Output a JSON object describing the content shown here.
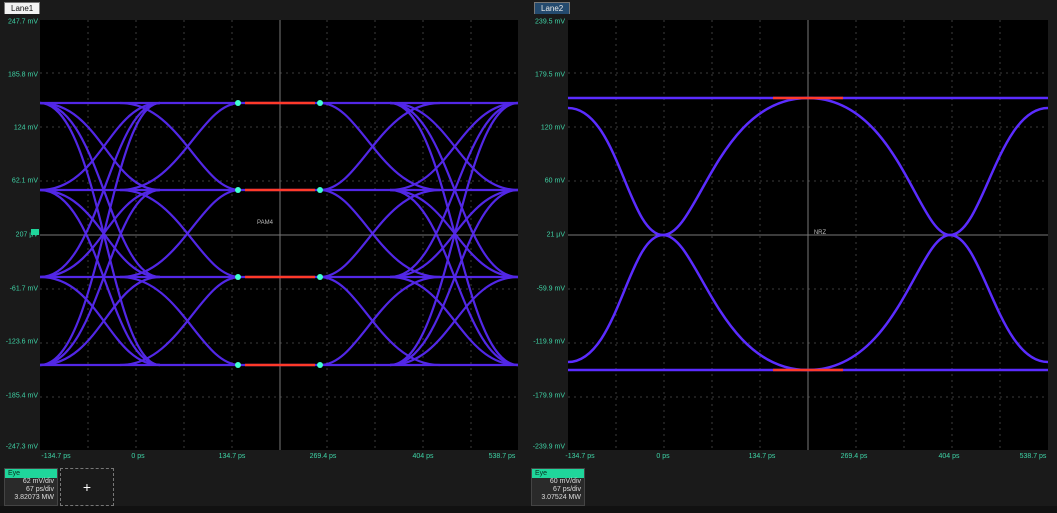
{
  "lane1": {
    "tab": "Lane1",
    "center_label": "PAM4",
    "y_ticks": [
      "247.7 mV",
      "185.8 mV",
      "124 mV",
      "62.1 mV",
      "207 µV",
      "-61.7 mV",
      "-123.6 mV",
      "-185.4 mV",
      "-247.3 mV"
    ],
    "x_ticks": [
      "-134.7 ps",
      "0 ps",
      "134.7 ps",
      "269.4 ps",
      "404 ps",
      "538.7 ps"
    ],
    "info": {
      "title": "Eye",
      "line1": "62 mV/div",
      "line2": "67 ps/div",
      "line3": "3.82073 MW"
    },
    "add_label": "+"
  },
  "lane2": {
    "tab": "Lane2",
    "center_label": "NRZ",
    "y_ticks": [
      "239.5 mV",
      "179.5 mV",
      "120 mV",
      "60 mV",
      "21 µV",
      "-59.9 mV",
      "-119.9 mV",
      "-179.9 mV",
      "-239.9 mV"
    ],
    "x_ticks": [
      "-134.7 ps",
      "0 ps",
      "134.7 ps",
      "269.4 ps",
      "404 ps",
      "538.7 ps"
    ],
    "info": {
      "title": "Eye",
      "line1": "60 mV/div",
      "line2": "67 ps/div",
      "line3": "3.07524 MW"
    }
  },
  "colors": {
    "trace": "#5b2cff",
    "hot": "#ff3a2a",
    "grid": "#3c3c3c",
    "axis_text": "#3fd3a6"
  }
}
